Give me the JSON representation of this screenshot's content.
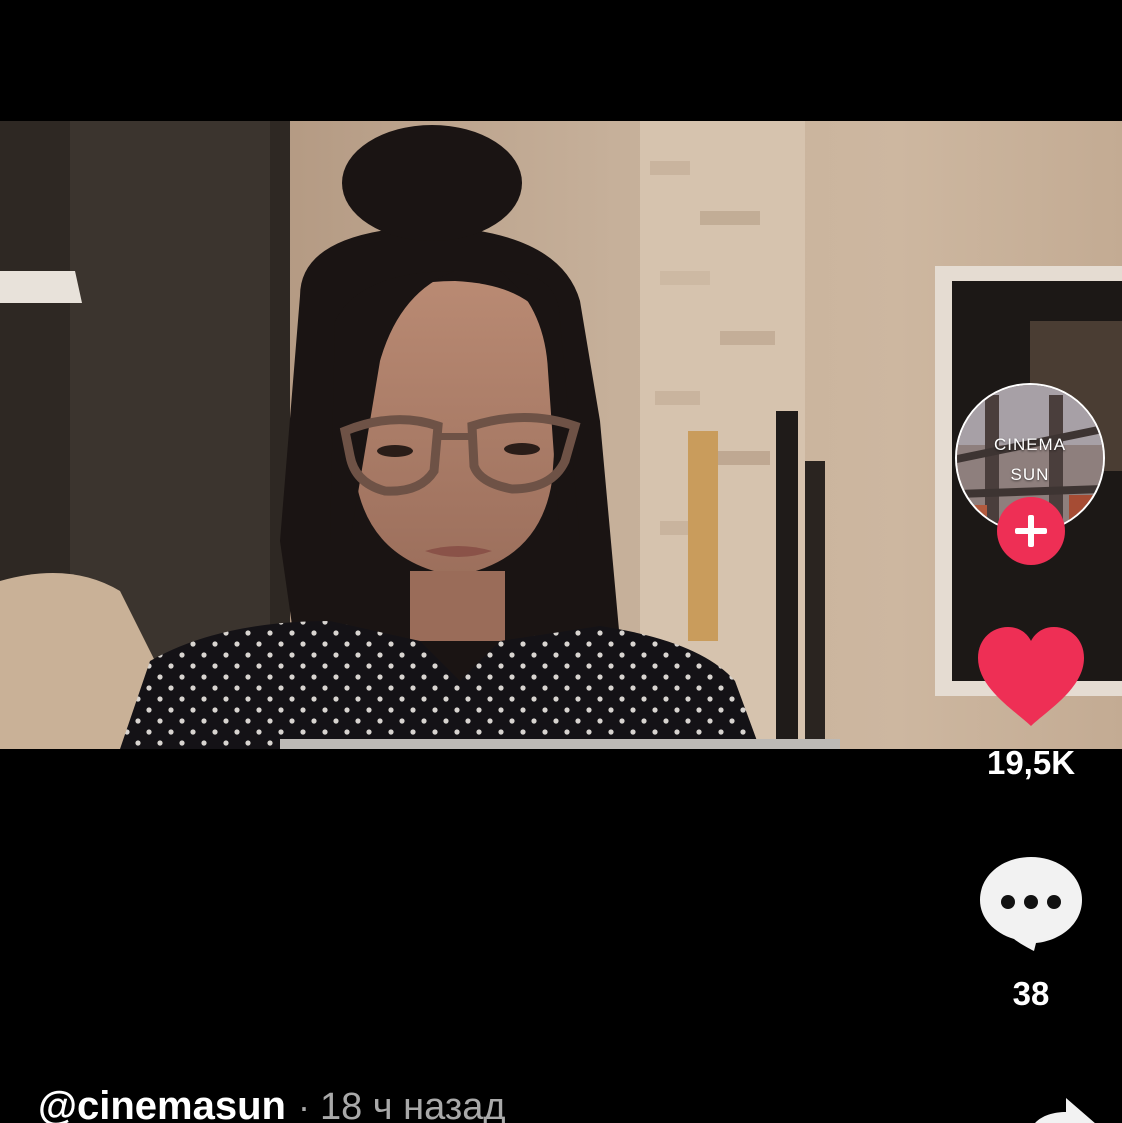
{
  "author": {
    "username": "@cinemasun",
    "separator": "·",
    "posted": "18 ч назад",
    "avatar_line1": "CINEMA",
    "avatar_line2": "SUN"
  },
  "actions": {
    "like_count": "19,5K",
    "comment_count": "38",
    "like_icon": "heart-icon",
    "comment_icon": "speech-bubble-icon",
    "share_icon": "share-arrow-icon",
    "follow_icon": "plus-icon"
  },
  "colors": {
    "background": "#000000",
    "like_red": "#ee2f55",
    "follow_red": "#ee2f55",
    "secondary_text": "#a9a9a9"
  }
}
